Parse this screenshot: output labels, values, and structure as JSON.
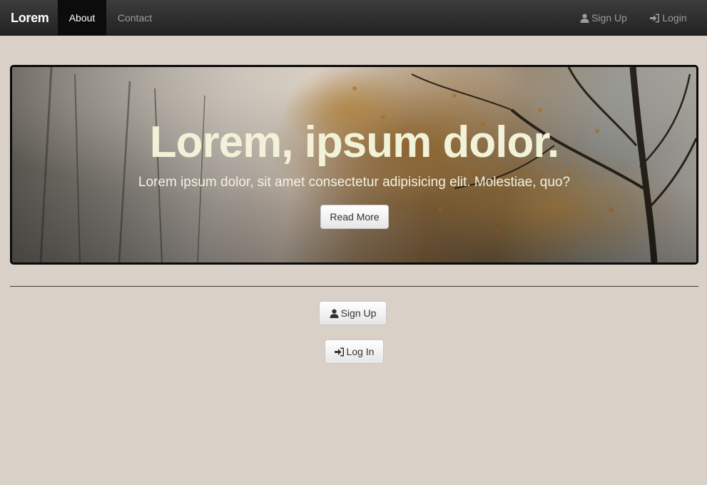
{
  "navbar": {
    "brand": "Lorem",
    "links": {
      "about": "About",
      "contact": "Contact",
      "signup": "Sign Up",
      "login": "Login"
    },
    "active_link": "About"
  },
  "hero": {
    "title": "Lorem, ipsum dolor.",
    "subtitle": "Lorem ipsum dolor, sit amet consectetur adipisicing elit. Molestiae, quo?",
    "button_label": "Read More"
  },
  "actions": {
    "signup_label": "Sign Up",
    "login_label": "Log In"
  },
  "icons": {
    "user": "user-icon",
    "login": "log-in-icon"
  },
  "colors": {
    "page_background": "#d9d0c7",
    "navbar_background": "#222222",
    "hero_text": "#f2f2d8"
  }
}
